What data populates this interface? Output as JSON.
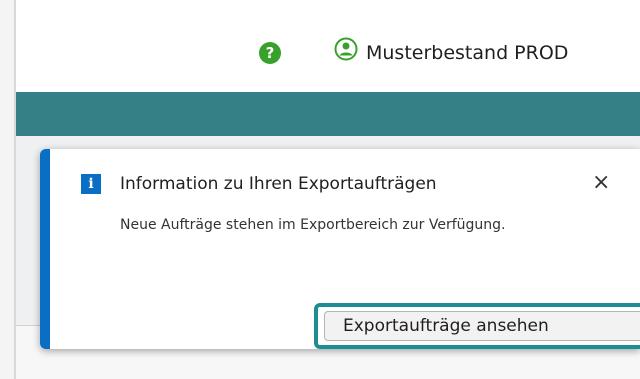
{
  "header": {
    "help_icon_label": "?",
    "user_name": "Musterbestand PROD"
  },
  "notification": {
    "title": "Information zu Ihren Exportaufträgen",
    "message": "Neue Aufträge stehen im Exportbereich zur Verfügung.",
    "close_label": "×",
    "action_label": "Exportaufträge ansehen"
  },
  "colors": {
    "accent_teal": "#357f86",
    "info_blue": "#0a6fc4",
    "help_green": "#38a12b",
    "highlight": "#1c8e92"
  }
}
